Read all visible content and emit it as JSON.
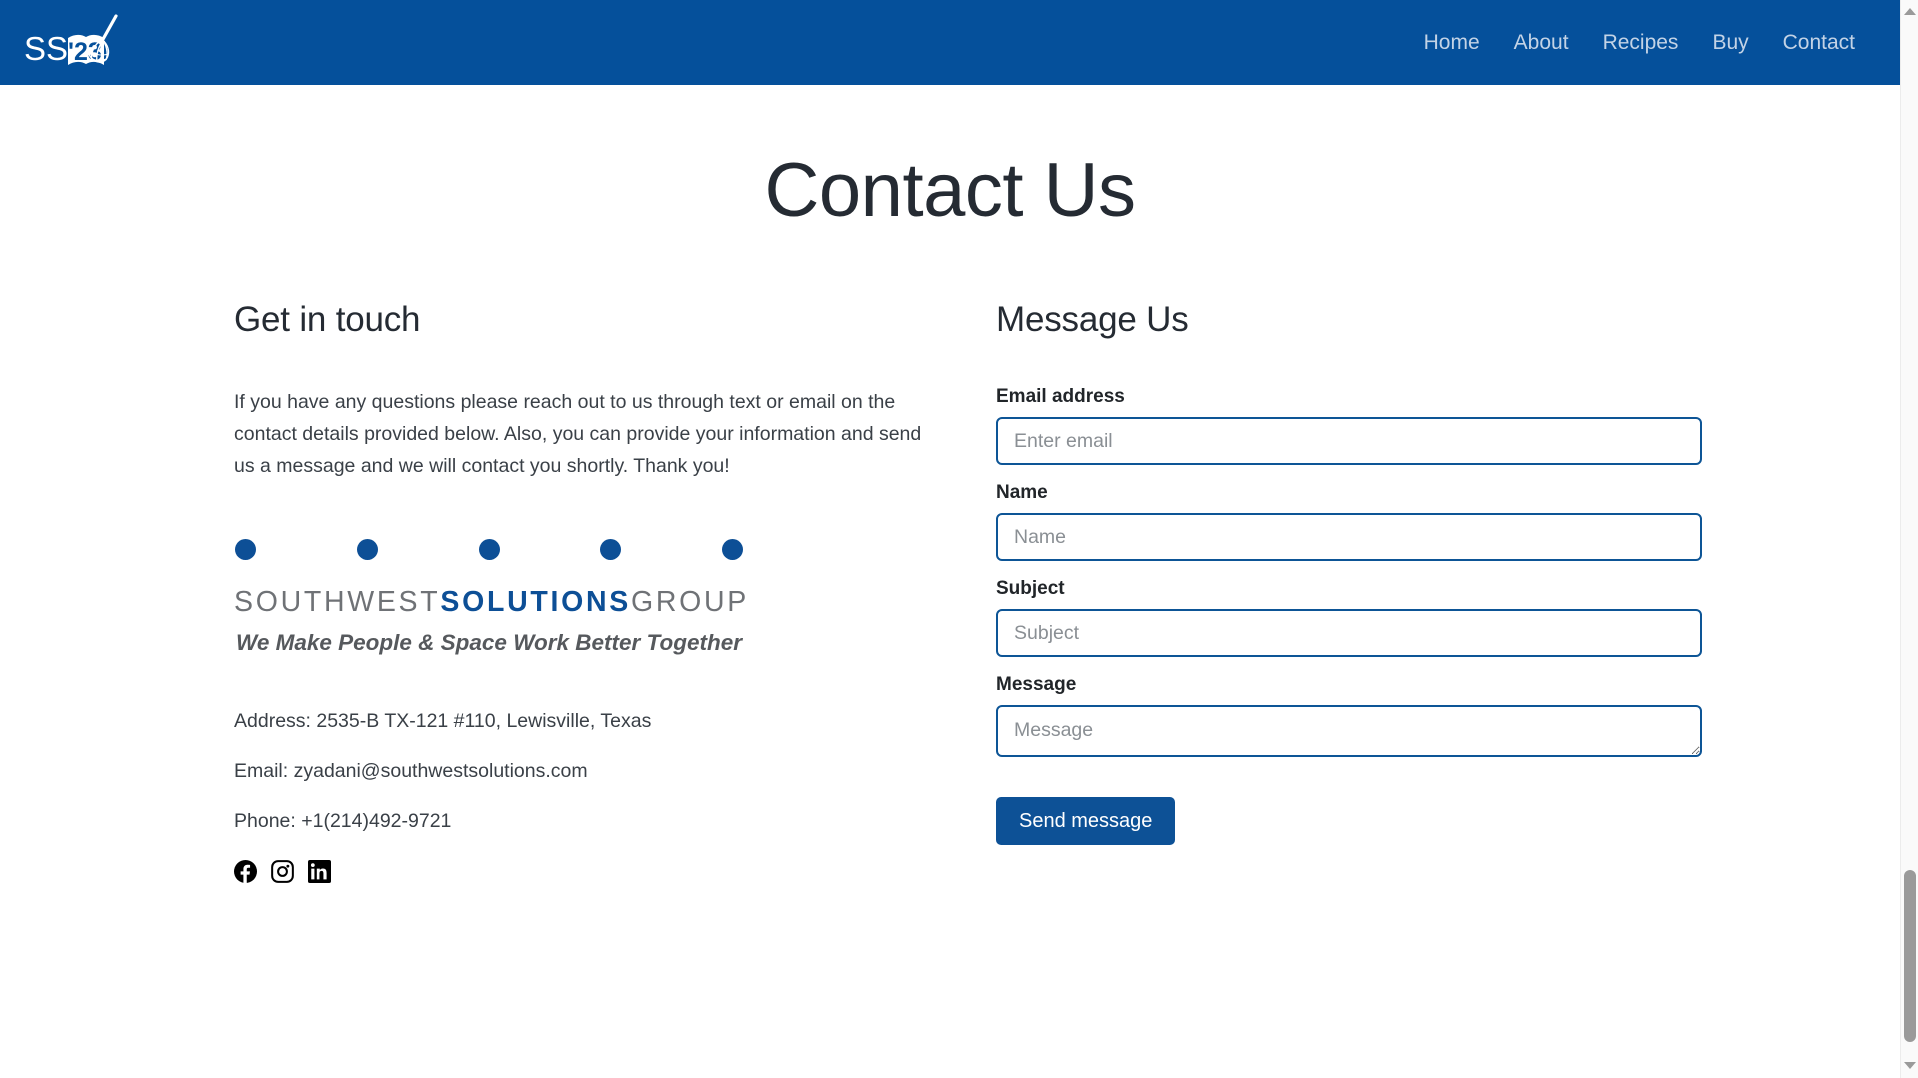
{
  "navbar": {
    "brand": {
      "text": "SSG",
      "year": "'23",
      "icon_names": [
        "open-book-icon",
        "whisk-icon"
      ]
    },
    "links": [
      {
        "label": "Home"
      },
      {
        "label": "About"
      },
      {
        "label": "Recipes"
      },
      {
        "label": "Buy"
      },
      {
        "label": "Contact"
      }
    ]
  },
  "page": {
    "title": "Contact Us"
  },
  "get_in_touch": {
    "heading": "Get in touch",
    "intro": "If you have any questions please reach out to us through text or email on the contact details provided below. Also, you can provide your information and send us a message and we will contact you shortly. Thank you!",
    "partner_logo": {
      "word_part_1": "SOUTHWEST",
      "word_part_2": "SOLUTIONS",
      "word_part_3": "GROUP",
      "tagline": "We Make People & Space Work Better Together",
      "dot_count": 5
    },
    "details": [
      {
        "text": "Address: 2535-B TX-121 #110, Lewisville, Texas"
      },
      {
        "text": "Email: zyadani@southwestsolutions.com"
      },
      {
        "text": "Phone: +1(214)492-9721"
      }
    ],
    "socials": [
      {
        "name": "facebook-icon",
        "label": "Facebook"
      },
      {
        "name": "instagram-icon",
        "label": "Instagram"
      },
      {
        "name": "linkedin-icon",
        "label": "LinkedIn"
      }
    ]
  },
  "message_form": {
    "heading": "Message Us",
    "fields": [
      {
        "label": "Email address",
        "placeholder": "Enter email",
        "value": ""
      },
      {
        "label": "Name",
        "placeholder": "Name",
        "value": ""
      },
      {
        "label": "Subject",
        "placeholder": "Subject",
        "value": ""
      },
      {
        "label": "Message",
        "placeholder": "Message",
        "value": ""
      }
    ],
    "submit_label": "Send message"
  },
  "colors": {
    "brand_blue": "#05509b",
    "accent_blue": "#0d5196",
    "logo_blue": "#0d4f96",
    "text_dark": "#252b33",
    "text_body": "#3a4047",
    "nav_link": "#c3d3e6"
  }
}
